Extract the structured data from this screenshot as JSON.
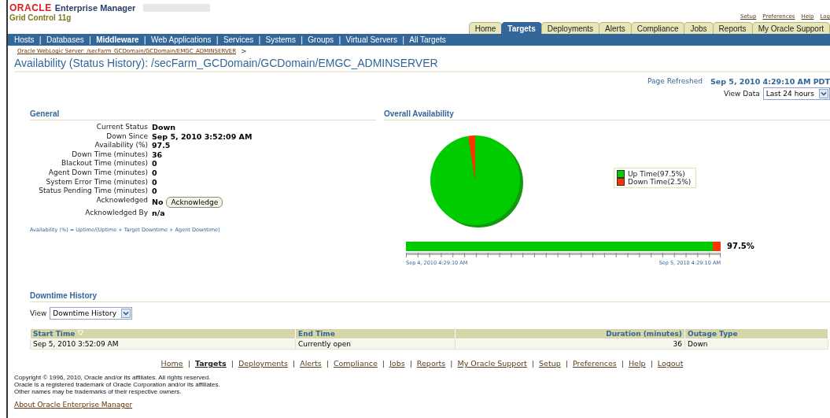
{
  "header": {
    "brand": "ORACLE",
    "product": "Enterprise Manager",
    "subtitle": "Grid Control 11g",
    "global_links": [
      "Setup",
      "Preferences",
      "Help",
      "Log"
    ]
  },
  "tabs": [
    {
      "label": "Home",
      "selected": false
    },
    {
      "label": "Targets",
      "selected": true
    },
    {
      "label": "Deployments",
      "selected": false
    },
    {
      "label": "Alerts",
      "selected": false
    },
    {
      "label": "Compliance",
      "selected": false
    },
    {
      "label": "Jobs",
      "selected": false
    },
    {
      "label": "Reports",
      "selected": false
    },
    {
      "label": "My Oracle Support",
      "selected": false
    }
  ],
  "nav": {
    "separator": "|",
    "items": [
      {
        "label": "Hosts",
        "selected": false
      },
      {
        "label": "Databases",
        "selected": false
      },
      {
        "label": "Middleware",
        "selected": true
      },
      {
        "label": "Web Applications",
        "selected": false
      },
      {
        "label": "Services",
        "selected": false
      },
      {
        "label": "Systems",
        "selected": false
      },
      {
        "label": "Groups",
        "selected": false
      },
      {
        "label": "Virtual Servers",
        "selected": false
      },
      {
        "label": "All Targets",
        "selected": false
      }
    ]
  },
  "breadcrumb": {
    "link": "Oracle WebLogic Server: /secFarm_GCDomain/GCDomain/EMGC_ADMINSERVER",
    "separator": ">"
  },
  "page_title": "Availability (Status History): /secFarm_GCDomain/GCDomain/EMGC_ADMINSERVER",
  "refresh": {
    "label": "Page Refreshed",
    "value": "Sep 5, 2010 4:29:10 AM PDT"
  },
  "view_data": {
    "label": "View Data",
    "value": "Last 24 hours"
  },
  "general": {
    "title": "General",
    "rows": [
      {
        "label": "Current Status",
        "value": "Down"
      },
      {
        "label": "Down Since",
        "value": "Sep 5, 2010 3:52:09 AM"
      },
      {
        "label": "Availability (%)",
        "value": "97.5"
      },
      {
        "label": "Down Time (minutes)",
        "value": "36"
      },
      {
        "label": "Blackout Time (minutes)",
        "value": "0"
      },
      {
        "label": "Agent Down Time (minutes)",
        "value": "0"
      },
      {
        "label": "System Error Time (minutes)",
        "value": "0"
      },
      {
        "label": "Status Pending Time (minutes)",
        "value": "0"
      },
      {
        "label": "Acknowledged",
        "value": "No",
        "button": "Acknowledge"
      },
      {
        "label": "Acknowledged By",
        "value": "n/a"
      }
    ],
    "formula": "Availability (%) = Uptime/(Uptime + Target Downtime + Agent Downtime)"
  },
  "overall": {
    "title": "Overall Availability",
    "chart_data": {
      "type": "pie",
      "categories": [
        "Up Time(97.5%)",
        "Down Time(2.5%)"
      ],
      "values": [
        97.5,
        2.5
      ]
    },
    "bar": {
      "level": 0.975,
      "reading": "97.5%",
      "start_label": "Sep 4, 2010 4:29:10 AM",
      "end_label": "Sep 5, 2010 4:29:10 AM"
    }
  },
  "downtime": {
    "title": "Downtime History",
    "view_label": "View",
    "view_value": "Downtime History",
    "columns": [
      "Start Time",
      "End Time",
      "Duration (minutes)",
      "Outage Type"
    ],
    "rows": [
      [
        "Sep 5, 2010 3:52:09 AM",
        "Currently open",
        "36",
        "Down"
      ]
    ]
  },
  "footer": {
    "separator": "|",
    "links": [
      {
        "label": "Home",
        "selected": false
      },
      {
        "label": "Targets",
        "selected": true
      },
      {
        "label": "Deployments",
        "selected": false
      },
      {
        "label": "Alerts",
        "selected": false
      },
      {
        "label": "Compliance",
        "selected": false
      },
      {
        "label": "Jobs",
        "selected": false
      },
      {
        "label": "Reports",
        "selected": false
      },
      {
        "label": "My Oracle Support",
        "selected": false
      },
      {
        "label": "Setup",
        "selected": false
      },
      {
        "label": "Preferences",
        "selected": false
      },
      {
        "label": "Help",
        "selected": false
      },
      {
        "label": "Logout",
        "selected": false
      }
    ],
    "copyright": [
      "Copyright © 1996, 2010, Oracle and/or its affiliates. All rights reserved.",
      "Oracle is a registered trademark of Oracle Corporation and/or its affiliates.",
      "Other names may be trademarks of their respective owners."
    ],
    "about": "About Oracle Enterprise Manager"
  }
}
